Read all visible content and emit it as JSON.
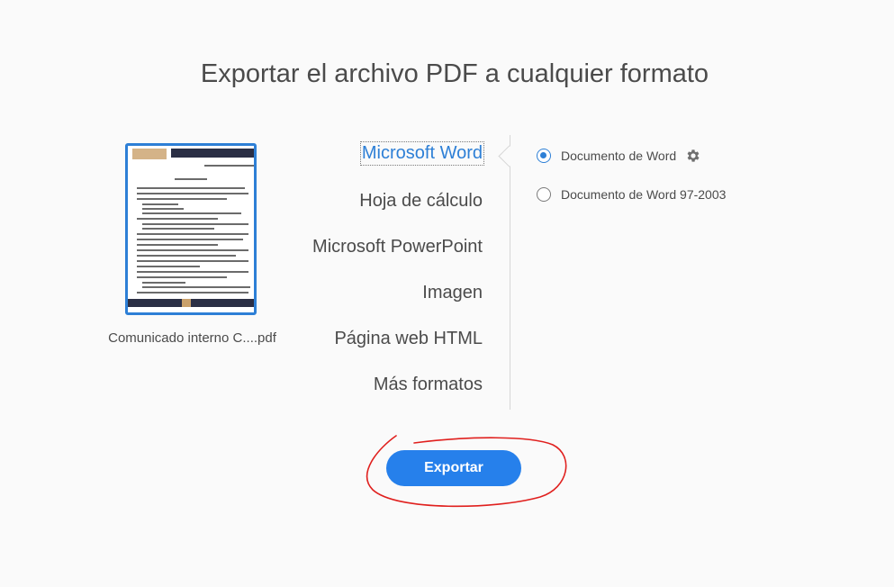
{
  "title": "Exportar el archivo PDF a cualquier formato",
  "file": {
    "name": "Comunicado interno C....pdf"
  },
  "formats": [
    {
      "label": "Microsoft Word",
      "selected": true
    },
    {
      "label": "Hoja de cálculo",
      "selected": false
    },
    {
      "label": "Microsoft PowerPoint",
      "selected": false
    },
    {
      "label": "Imagen",
      "selected": false
    },
    {
      "label": "Página web HTML",
      "selected": false
    },
    {
      "label": "Más formatos",
      "selected": false
    }
  ],
  "options": [
    {
      "label": "Documento de Word",
      "checked": true,
      "icon": "gear-icon"
    },
    {
      "label": "Documento de Word 97-2003",
      "checked": false
    }
  ],
  "export_button": {
    "label": "Exportar"
  },
  "colors": {
    "accent": "#2d7fd6",
    "button": "#2680eb",
    "annotation": "#e0201e"
  }
}
